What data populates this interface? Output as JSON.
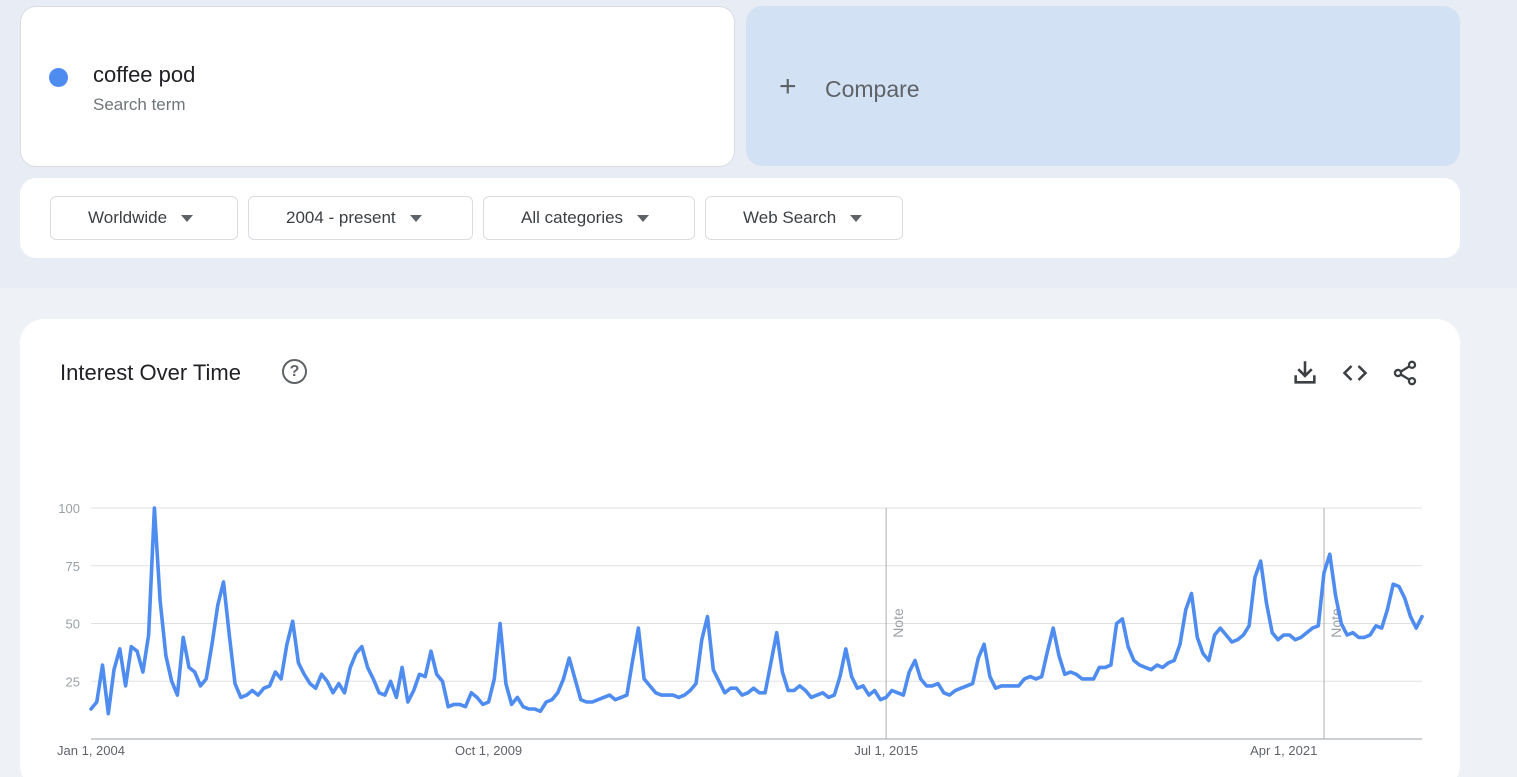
{
  "search_term": {
    "name": "coffee pod",
    "type_label": "Search term",
    "color": "#4f8cf0"
  },
  "compare": {
    "plus": "+",
    "label": "Compare"
  },
  "filters": {
    "region": "Worldwide",
    "time_range": "2004 - present",
    "category": "All categories",
    "property": "Web Search"
  },
  "chart": {
    "title": "Interest Over Time",
    "help": "?",
    "icons": [
      "download-icon",
      "embed-icon",
      "share-icon"
    ]
  },
  "chart_data": {
    "type": "line",
    "ylim": [
      0,
      100
    ],
    "yticks": [
      25,
      50,
      75,
      100
    ],
    "grid": true,
    "x_tick_labels": [
      "Jan 1, 2004",
      "Oct 1, 2009",
      "Jul 1, 2015",
      "Apr 1, 2021"
    ],
    "x_tick_months": [
      0,
      69,
      138,
      207
    ],
    "notes": [
      {
        "label": "Note",
        "month": 138
      },
      {
        "label": "Note",
        "month": 214
      }
    ],
    "series": [
      {
        "color": "#4f8cf0",
        "start": "2004-01",
        "frequency": "monthly",
        "values": [
          13,
          16,
          32,
          11,
          30,
          39,
          23,
          40,
          38,
          29,
          45,
          100,
          60,
          36,
          25,
          19,
          44,
          31,
          29,
          23,
          26,
          41,
          58,
          68,
          45,
          24,
          18,
          19,
          21,
          19,
          22,
          23,
          29,
          26,
          41,
          51,
          33,
          28,
          24,
          22,
          28,
          25,
          20,
          24,
          20,
          31,
          37,
          40,
          31,
          26,
          20,
          19,
          25,
          18,
          31,
          16,
          21,
          28,
          27,
          38,
          28,
          25,
          14,
          15,
          15,
          14,
          20,
          18,
          15,
          16,
          26,
          50,
          24,
          15,
          18,
          14,
          13,
          13,
          12,
          16,
          17,
          20,
          26,
          35,
          26,
          17,
          16,
          16,
          17,
          18,
          19,
          17,
          18,
          19,
          34,
          48,
          26,
          23,
          20,
          19,
          19,
          19,
          18,
          19,
          21,
          24,
          43,
          53,
          30,
          25,
          20,
          22,
          22,
          19,
          20,
          22,
          20,
          20,
          33,
          46,
          29,
          21,
          21,
          23,
          21,
          18,
          19,
          20,
          18,
          19,
          27,
          39,
          27,
          22,
          23,
          19,
          21,
          17,
          18,
          21,
          20,
          19,
          29,
          34,
          26,
          23,
          23,
          24,
          20,
          19,
          21,
          22,
          23,
          24,
          35,
          41,
          27,
          22,
          23,
          23,
          23,
          23,
          26,
          27,
          26,
          27,
          38,
          48,
          36,
          28,
          29,
          28,
          26,
          26,
          26,
          31,
          31,
          32,
          50,
          52,
          40,
          34,
          32,
          31,
          30,
          32,
          31,
          33,
          34,
          41,
          56,
          63,
          44,
          37,
          34,
          45,
          48,
          45,
          42,
          43,
          45,
          49,
          70,
          77,
          59,
          46,
          43,
          45,
          45,
          43,
          44,
          46,
          48,
          49,
          72,
          80,
          62,
          50,
          45,
          46,
          44,
          44,
          45,
          49,
          48,
          56,
          67,
          66,
          61,
          53,
          48,
          53
        ]
      }
    ]
  }
}
